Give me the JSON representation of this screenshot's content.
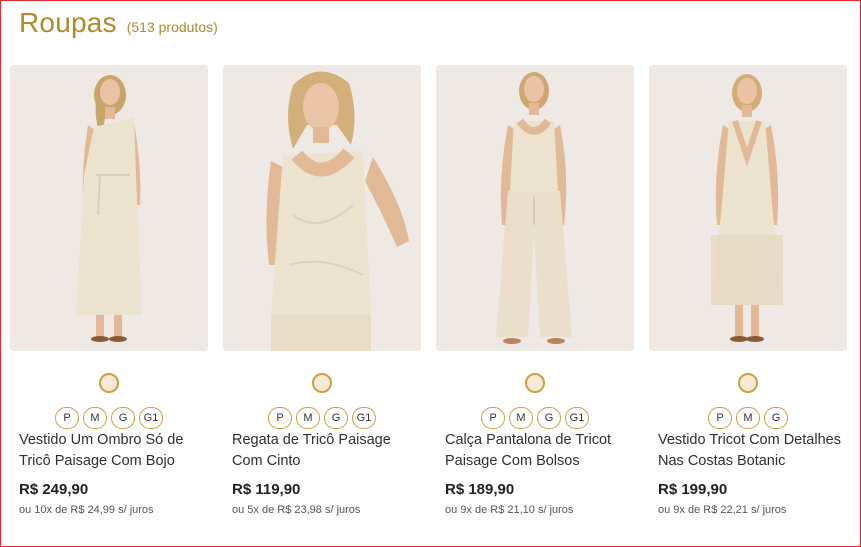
{
  "header": {
    "title": "Roupas",
    "count": "(513 produtos)"
  },
  "colors": {
    "accent": "#b08a2e",
    "swatch_fill": "#f4ead7",
    "swatch_border": "#c9a13d",
    "page_border": "#e4262c"
  },
  "products": [
    {
      "name": "Vestido Um Ombro Só de Tricô Paisage Com Bojo",
      "price": "R$ 249,90",
      "installments": "ou 10x de R$ 24,99 s/ juros",
      "sizes": [
        "P",
        "M",
        "G",
        "G1"
      ]
    },
    {
      "name": "Regata de Tricô Paisage Com Cinto",
      "price": "R$ 119,90",
      "installments": "ou 5x de R$ 23,98 s/ juros",
      "sizes": [
        "P",
        "M",
        "G",
        "G1"
      ]
    },
    {
      "name": "Calça Pantalona de Tricot Paisage Com Bolsos",
      "price": "R$ 189,90",
      "installments": "ou 9x de R$ 21,10 s/ juros",
      "sizes": [
        "P",
        "M",
        "G",
        "G1"
      ]
    },
    {
      "name": "Vestido Tricot Com Detalhes Nas Costas Botanic",
      "price": "R$ 199,90",
      "installments": "ou 9x de R$ 22,21 s/ juros",
      "sizes": [
        "P",
        "M",
        "G"
      ]
    }
  ]
}
